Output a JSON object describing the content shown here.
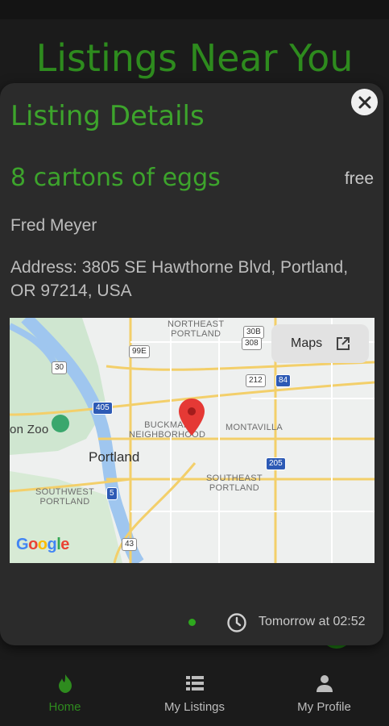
{
  "header": {
    "title": "Listings Near You"
  },
  "modal": {
    "title": "Listing Details",
    "close_icon": "close-icon",
    "item": "8 cartons of eggs",
    "price": "free",
    "store": "Fred Meyer",
    "address": "Address: 3805 SE Hawthorne Blvd, Portland, OR 97214, USA",
    "map": {
      "button_label": "Maps",
      "button_icon": "external-link-icon",
      "pin_icon": "map-pin-icon",
      "logo": "Google",
      "city": "Portland",
      "labels": {
        "northeast": "NORTHEAST\nPORTLAND",
        "buckman": "BUCKMAN\nNEIGHBORHOOD",
        "montavilla": "MONTAVILLA",
        "southeast": "SOUTHEAST\nPORTLAND",
        "southwest": "SOUTHWEST\nPORTLAND",
        "zoo": "on Zoo"
      },
      "shields": [
        "30",
        "99E",
        "405",
        "5",
        "43",
        "84",
        "205",
        "212",
        "BYP 30B",
        "308"
      ]
    },
    "pickup_time": "Tomorrow at 02:52",
    "pickup_icon": "clock-icon"
  },
  "nav": {
    "items": [
      {
        "label": "Home",
        "icon": "flame-icon",
        "active": true
      },
      {
        "label": "My Listings",
        "icon": "list-icon",
        "active": false
      },
      {
        "label": "My Profile",
        "icon": "person-icon",
        "active": false
      }
    ]
  },
  "colors": {
    "accent": "#3da42c",
    "background": "#1b1b1b",
    "card": "#2b2b2b",
    "pin": "#e53935"
  }
}
